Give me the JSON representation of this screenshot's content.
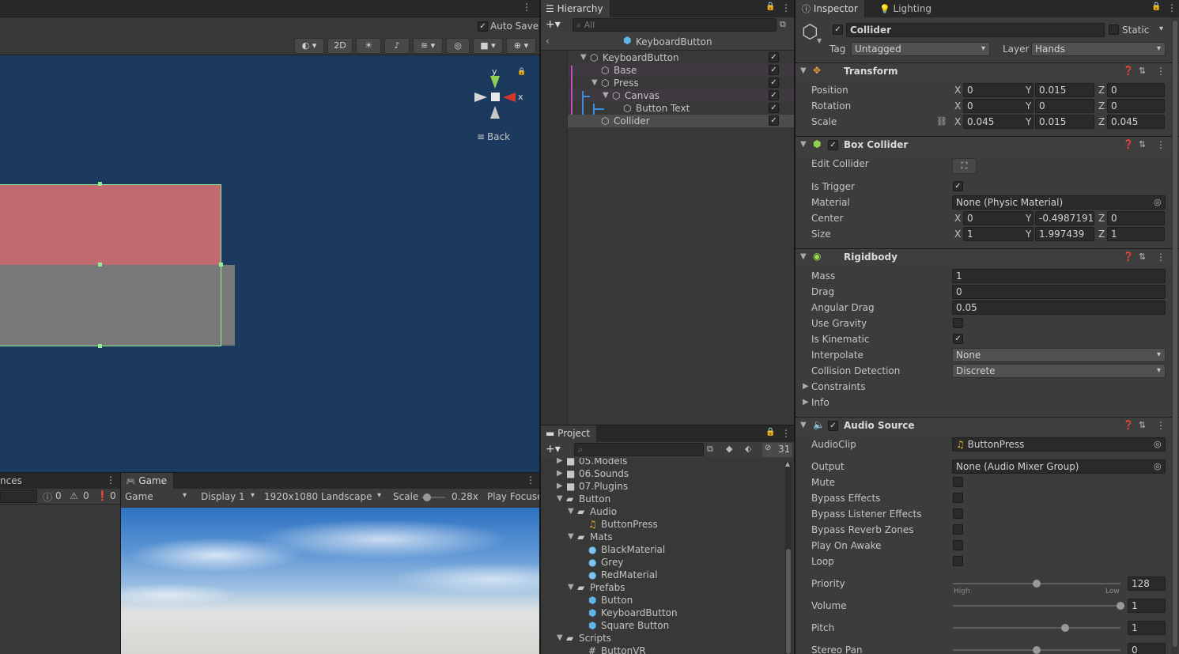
{
  "scene": {
    "auto_save_label": "Auto Save",
    "btn_2d": "2D",
    "gizmo_y": "y",
    "gizmo_x": "x",
    "back_label": "Back"
  },
  "console": {
    "tab_label": "nces",
    "count_info": "0",
    "count_warn": "0",
    "count_err": "0"
  },
  "game": {
    "tab_label": "Game",
    "view_select": "Game",
    "display_select": "Display 1",
    "resolution_select": "1920x1080 Landscape",
    "scale_label": "Scale",
    "scale_value": "0.28x",
    "play_focus": "Play Focuse"
  },
  "hierarchy": {
    "tab_label": "Hierarchy",
    "search_placeholder": "All",
    "prefab_root": "KeyboardButton",
    "items": [
      {
        "label": "KeyboardButton"
      },
      {
        "label": "Base"
      },
      {
        "label": "Press"
      },
      {
        "label": "Canvas"
      },
      {
        "label": "Button Text"
      },
      {
        "label": "Collider"
      }
    ]
  },
  "project": {
    "tab_label": "Project",
    "hidden_count": "31",
    "items": [
      {
        "label": "05.Models"
      },
      {
        "label": "06.Sounds"
      },
      {
        "label": "07.Plugins"
      },
      {
        "label": "Button"
      },
      {
        "label": "Audio"
      },
      {
        "label": "ButtonPress"
      },
      {
        "label": "Mats"
      },
      {
        "label": "BlackMaterial"
      },
      {
        "label": "Grey"
      },
      {
        "label": "RedMaterial"
      },
      {
        "label": "Prefabs"
      },
      {
        "label": "Button"
      },
      {
        "label": "KeyboardButton"
      },
      {
        "label": "Square Button"
      },
      {
        "label": "Scripts"
      },
      {
        "label": "ButtonVR"
      }
    ]
  },
  "inspector": {
    "tab_label": "Inspector",
    "lighting_tab_label": "Lighting",
    "object_name": "Collider",
    "static_label": "Static",
    "tag_label": "Tag",
    "tag_value": "Untagged",
    "layer_label": "Layer",
    "layer_value": "Hands",
    "axis_x": "X",
    "axis_y": "Y",
    "axis_z": "Z",
    "transform": {
      "title": "Transform",
      "position_label": "Position",
      "rotation_label": "Rotation",
      "scale_label": "Scale",
      "position": {
        "x": "0",
        "y": "0.015",
        "z": "0"
      },
      "rotation": {
        "x": "0",
        "y": "0",
        "z": "0"
      },
      "scale": {
        "x": "0.045",
        "y": "0.015",
        "z": "0.045"
      }
    },
    "box_collider": {
      "title": "Box Collider",
      "edit_label": "Edit Collider",
      "is_trigger_label": "Is Trigger",
      "material_label": "Material",
      "material_value": "None (Physic Material)",
      "center_label": "Center",
      "size_label": "Size",
      "center": {
        "x": "0",
        "y": "-0.4987191",
        "z": "0"
      },
      "size": {
        "x": "1",
        "y": "1.997439",
        "z": "1"
      }
    },
    "rigidbody": {
      "title": "Rigidbody",
      "mass_label": "Mass",
      "mass": "1",
      "drag_label": "Drag",
      "drag": "0",
      "angular_drag_label": "Angular Drag",
      "angular_drag": "0.05",
      "use_gravity_label": "Use Gravity",
      "is_kinematic_label": "Is Kinematic",
      "interpolate_label": "Interpolate",
      "interpolate": "None",
      "collision_label": "Collision Detection",
      "collision": "Discrete",
      "constraints_label": "Constraints",
      "info_label": "Info"
    },
    "audio_source": {
      "title": "Audio Source",
      "clip_label": "AudioClip",
      "clip_value": "ButtonPress",
      "output_label": "Output",
      "output_value": "None (Audio Mixer Group)",
      "mute_label": "Mute",
      "bypass_effects_label": "Bypass Effects",
      "bypass_listener_label": "Bypass Listener Effects",
      "bypass_reverb_label": "Bypass Reverb Zones",
      "play_on_awake_label": "Play On Awake",
      "loop_label": "Loop",
      "priority_label": "Priority",
      "priority": "128",
      "priority_fraction": 0.5,
      "high_label": "High",
      "low_label": "Low",
      "volume_label": "Volume",
      "volume": "1",
      "volume_fraction": 1.0,
      "pitch_label": "Pitch",
      "pitch": "1",
      "pitch_fraction": 0.67,
      "stereo_pan_label": "Stereo Pan",
      "stereo_pan": "0",
      "stereo_pan_fraction": 0.5
    }
  }
}
